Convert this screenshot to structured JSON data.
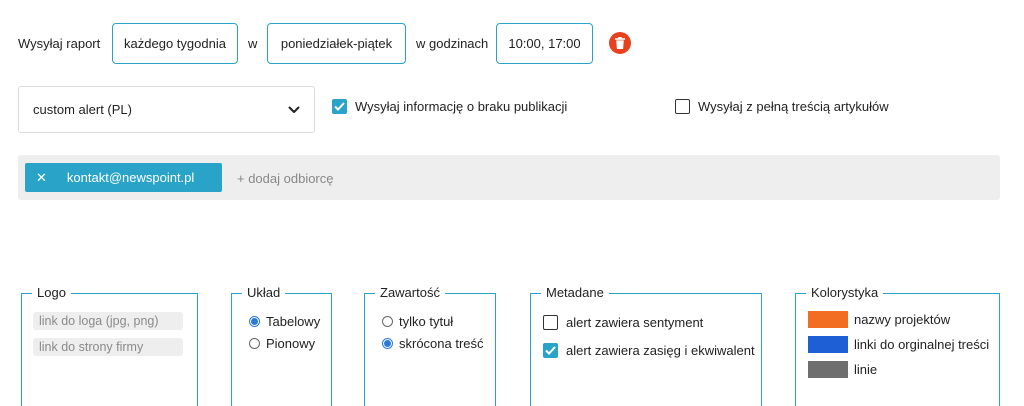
{
  "schedule": {
    "send_label": "Wysyłaj raport",
    "frequency_value": "każdego tygodnia",
    "w_label": "w",
    "days_value": "poniedziałek-piątek",
    "hours_label": "w godzinach",
    "hours_value": "10:00, 17:00",
    "delete_icon": "trash-icon"
  },
  "options": {
    "template_value": "custom alert (PL)",
    "no_publication": {
      "label": "Wysyłaj informację o braku publikacji",
      "checked": true
    },
    "full_content": {
      "label": "Wysyłaj z pełną treścią artykułów",
      "checked": false
    }
  },
  "recipients": {
    "chips": [
      {
        "email": "kontakt@newspoint.pl"
      }
    ],
    "add_placeholder": "+ dodaj odbiorcę"
  },
  "logo": {
    "legend": "Logo",
    "logo_placeholder": "link do loga (jpg, png)",
    "site_placeholder": "link do strony firmy"
  },
  "layout": {
    "legend": "Układ",
    "options": [
      {
        "label": "Tabelowy",
        "selected": true
      },
      {
        "label": "Pionowy",
        "selected": false
      }
    ]
  },
  "content": {
    "legend": "Zawartość",
    "options": [
      {
        "label": "tylko tytuł",
        "selected": false
      },
      {
        "label": "skrócona treść",
        "selected": true
      }
    ]
  },
  "metadata": {
    "legend": "Metadane",
    "options": [
      {
        "label": "alert zawiera sentyment",
        "checked": false
      },
      {
        "label": "alert zawiera zasięg i ekwiwalent",
        "checked": true
      }
    ]
  },
  "colors": {
    "legend": "Kolorystyka",
    "items": [
      {
        "label": "nazwy projektów",
        "color": "#f26d21"
      },
      {
        "label": "linki do orginalnej treści",
        "color": "#1f5fd6"
      },
      {
        "label": "linie",
        "color": "#6e6e6e"
      }
    ]
  },
  "accent_color": "#2aa3c9"
}
